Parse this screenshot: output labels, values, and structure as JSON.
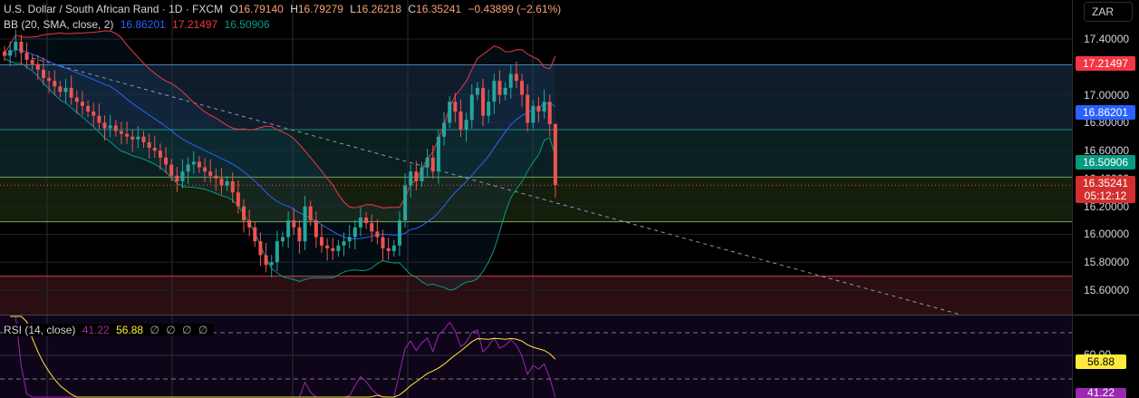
{
  "header": {
    "symbol": "U.S. Dollar / South African Rand · 1D · FXCM",
    "o_label": "O",
    "o": "16.79140",
    "h_label": "H",
    "h": "16.79279",
    "l_label": "L",
    "l": "16.26218",
    "c_label": "C",
    "c": "16.35241",
    "change": "−0.43899 (−2.61%)"
  },
  "bb": {
    "label": "BB (20, SMA, close, 2)",
    "basis": "16.86201",
    "upper": "17.21497",
    "lower": "16.50906"
  },
  "rsi": {
    "label": "RSI (14, close)",
    "value": "41.22",
    "ma": "56.88",
    "extra": [
      "∅",
      "∅",
      "∅",
      "∅"
    ],
    "ma_tag": "56.88",
    "value_tag": "41.22",
    "tick": "60.00"
  },
  "currency": "ZAR",
  "axis": {
    "ticks": [
      "17.40000",
      "17.00000",
      "16.80000",
      "16.60000",
      "16.40000",
      "16.20000",
      "16.00000",
      "15.80000",
      "15.60000"
    ]
  },
  "tags": {
    "upper": "17.21497",
    "basis": "16.86201",
    "lower": "16.50906",
    "price": "16.35241",
    "countdown": "05:12:12"
  },
  "colors": {
    "up": "#26a69a",
    "down": "#ef5350",
    "basis": "#2962ff",
    "upper": "#f23645",
    "lower": "#089981",
    "rsi": "#9c27b0",
    "rsi_ma": "#ffeb3b"
  },
  "chart_data": {
    "type": "candlestick",
    "ylim": [
      15.45,
      17.55
    ],
    "last": {
      "o": 16.7914,
      "h": 16.79279,
      "l": 16.26218,
      "c": 16.35241
    },
    "closes": [
      17.28,
      17.32,
      17.38,
      17.3,
      17.25,
      17.22,
      17.18,
      17.12,
      17.1,
      17.06,
      17.02,
      17.05,
      16.98,
      16.95,
      16.92,
      16.88,
      16.85,
      16.8,
      16.76,
      16.78,
      16.74,
      16.72,
      16.7,
      16.68,
      16.7,
      16.66,
      16.62,
      16.6,
      16.55,
      16.5,
      16.42,
      16.38,
      16.45,
      16.5,
      16.52,
      16.48,
      16.45,
      16.42,
      16.4,
      16.35,
      16.38,
      16.3,
      16.2,
      16.1,
      16.05,
      15.95,
      15.85,
      15.78,
      15.8,
      15.95,
      15.98,
      16.1,
      16.05,
      15.95,
      16.2,
      16.1,
      15.98,
      15.92,
      15.9,
      15.88,
      15.92,
      15.95,
      15.98,
      16.05,
      16.12,
      16.08,
      16.02,
      15.98,
      15.9,
      15.88,
      15.92,
      16.1,
      16.35,
      16.45,
      16.38,
      16.48,
      16.55,
      16.45,
      16.7,
      16.8,
      16.95,
      16.88,
      16.75,
      16.82,
      17.0,
      17.05,
      16.85,
      16.95,
      17.1,
      17.0,
      17.05,
      17.15,
      17.1,
      17.0,
      16.8,
      16.92,
      16.88,
      16.95,
      16.79,
      16.35
    ],
    "zones": [
      17.215,
      16.75,
      16.41,
      16.09,
      15.7
    ]
  }
}
